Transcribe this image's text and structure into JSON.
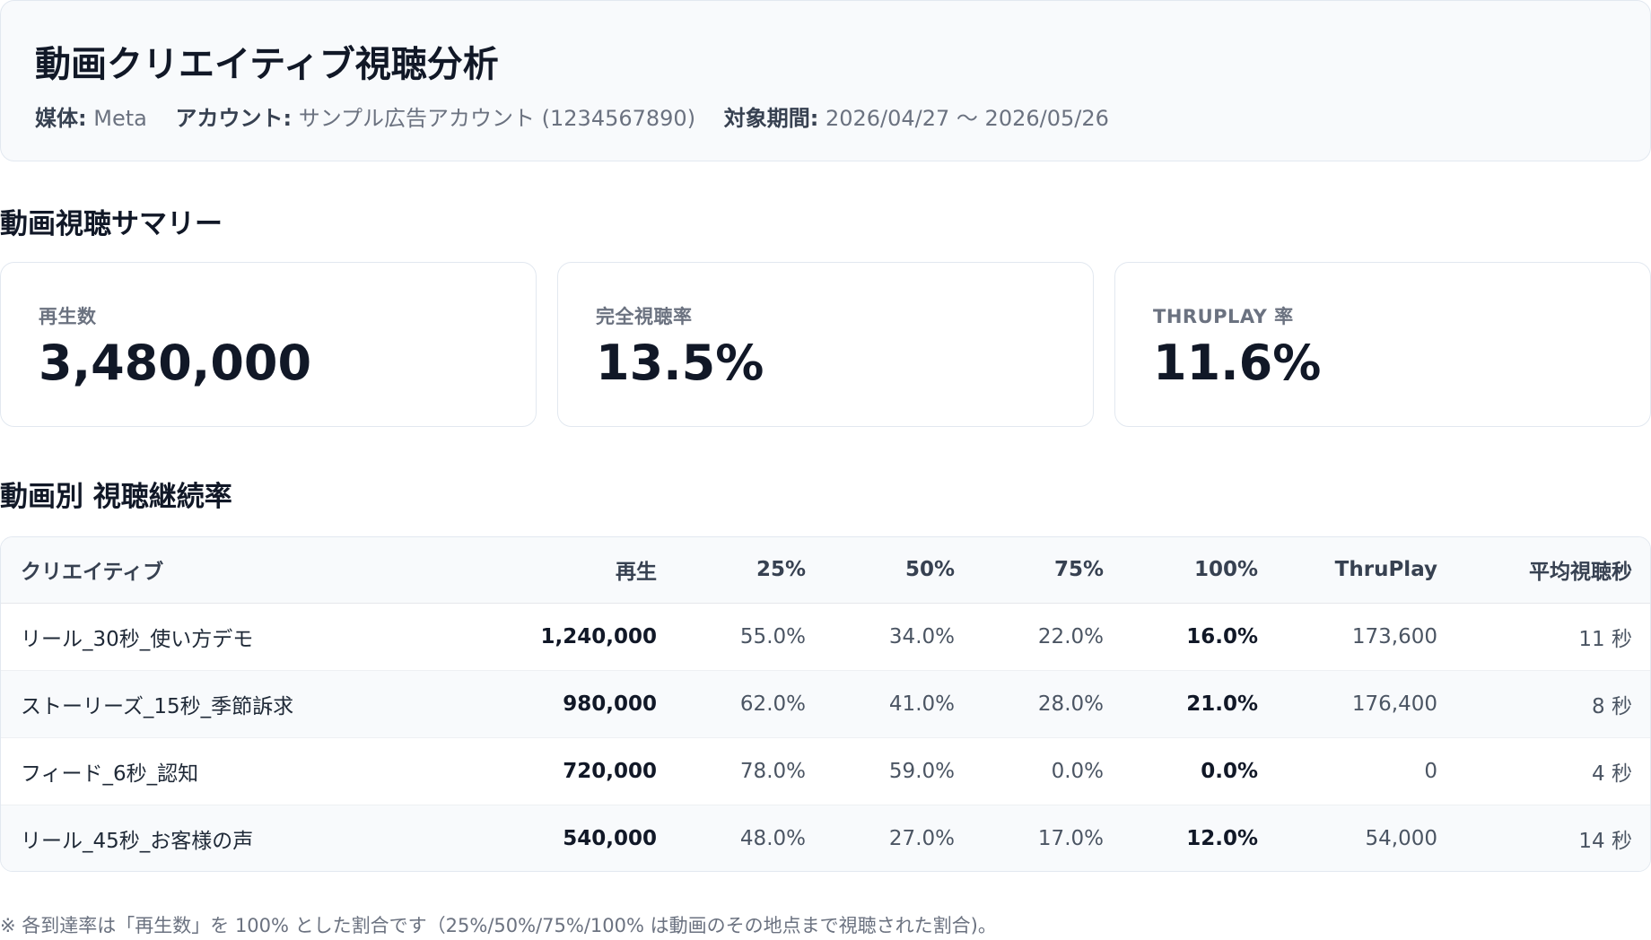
{
  "header": {
    "title": "動画クリエイティブ視聴分析",
    "meta": [
      {
        "label": "媒体",
        "value": "Meta"
      },
      {
        "label": "アカウント",
        "value": "サンプル広告アカウント (1234567890)"
      },
      {
        "label": "対象期間",
        "value": "2026/04/27 〜 2026/05/26"
      }
    ]
  },
  "summary": {
    "title": "動画視聴サマリー",
    "kpis": [
      {
        "label": "再生数",
        "value": "3,480,000"
      },
      {
        "label": "完全視聴率",
        "value": "13.5%"
      },
      {
        "label": "THRUPLAY 率",
        "value": "11.6%"
      }
    ]
  },
  "retention": {
    "title": "動画別 視聴継続率",
    "columns": [
      "クリエイティブ",
      "再生",
      "25%",
      "50%",
      "75%",
      "100%",
      "ThruPlay",
      "平均視聴秒"
    ],
    "rows": [
      [
        "リール_30秒_使い方デモ",
        "1,240,000",
        "55.0%",
        "34.0%",
        "22.0%",
        "16.0%",
        "173,600",
        "11 秒"
      ],
      [
        "ストーリーズ_15秒_季節訴求",
        "980,000",
        "62.0%",
        "41.0%",
        "28.0%",
        "21.0%",
        "176,400",
        "8 秒"
      ],
      [
        "フィード_6秒_認知",
        "720,000",
        "78.0%",
        "59.0%",
        "0.0%",
        "0.0%",
        "0",
        "4 秒"
      ],
      [
        "リール_45秒_お客様の声",
        "540,000",
        "48.0%",
        "27.0%",
        "17.0%",
        "12.0%",
        "54,000",
        "14 秒"
      ]
    ]
  },
  "footnote": "※ 各到達率は「再生数」を 100% とした割合です（25%/50%/75%/100% は動画のその地点まで視聴された割合)。"
}
